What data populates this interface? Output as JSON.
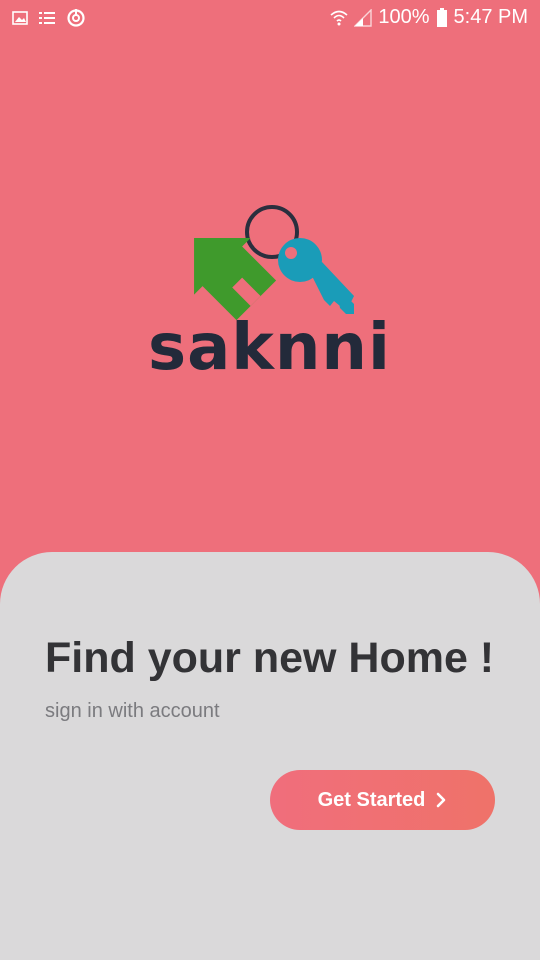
{
  "status_bar": {
    "battery": "100%",
    "time": "5:47 PM",
    "icons": [
      "image-icon",
      "list-icon",
      "sync-icon",
      "wifi-icon",
      "signal-icon",
      "battery-icon"
    ]
  },
  "logo": {
    "text": "saknni",
    "colors": {
      "house": "#3f9a2c",
      "key": "#1a9cb8",
      "ring": "#2a2f3e",
      "text": "#232a3a"
    }
  },
  "main": {
    "headline": "Find your new Home !",
    "subtitle": "sign in with account",
    "cta_label": "Get Started",
    "cta_icon": "chevron-right-icon"
  },
  "colors": {
    "background": "#ee6f7b",
    "sheet": "#dad9da",
    "button": "#f06e7c"
  }
}
